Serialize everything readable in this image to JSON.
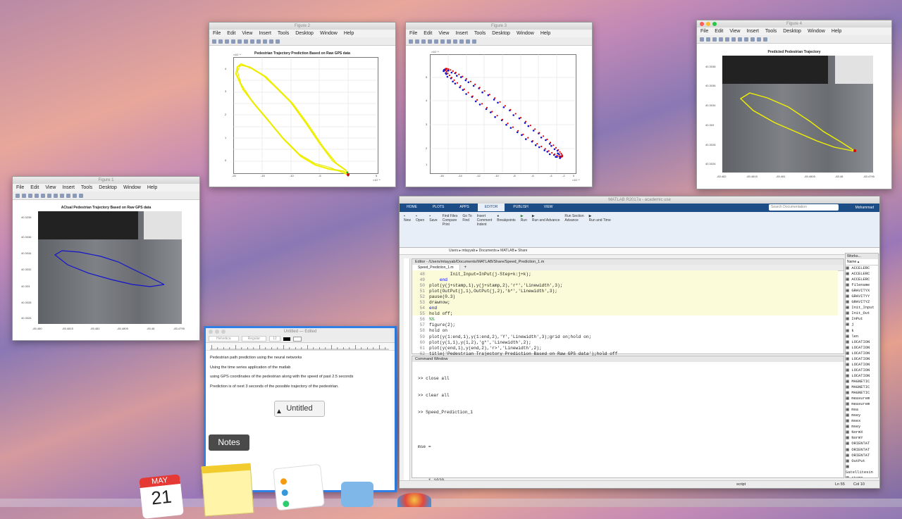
{
  "menus": [
    "File",
    "Edit",
    "View",
    "Insert",
    "Tools",
    "Desktop",
    "Window",
    "Help"
  ],
  "fig1": {
    "title": "Figure 1",
    "plot_title": "ACtual Pedestrian Trajectory Based on Raw GPS data",
    "xticks": [
      "-83.480",
      "-83.4815",
      "-83.481",
      "-83.4805",
      "-83.48",
      "-83.4795"
    ],
    "yticks": [
      "40.3238",
      "40.3036",
      "40.3034",
      "40.3032",
      "40.303",
      "40.3028",
      "40.3026"
    ]
  },
  "fig2": {
    "title": "Figure 2",
    "plot_title": "Pedestrian Trajectory Prediction Based on Raw GPS data",
    "xticks": [
      "-20",
      "-15",
      "-10",
      "-5",
      "0",
      "5"
    ],
    "yticks": [
      "4.5",
      "4",
      "3.5",
      "3",
      "2.5",
      "2",
      "1.5",
      "1",
      "0.5",
      "0",
      "-0.5"
    ],
    "exp_x": "×10⁻⁴",
    "exp_y": "×10⁻⁴"
  },
  "fig3": {
    "title": "Figure 3",
    "xticks": [
      "-16",
      "-14",
      "-12",
      "-10",
      "-8",
      "-6",
      "-4",
      "-2",
      "0"
    ],
    "yticks": [
      "5",
      "4",
      "3",
      "2",
      "1",
      "0"
    ],
    "exp_x": "×10⁻⁴",
    "exp_y": "×10⁻⁴"
  },
  "fig4": {
    "title": "Figure 4",
    "plot_title": "Predicted Pedestrian Trajectory",
    "xticks": [
      "-83.482",
      "-83.4815",
      "-83.481",
      "-83.4805",
      "-83.48",
      "-83.4795"
    ],
    "yticks": [
      "40.3038",
      "40.3036",
      "40.3034",
      "40.303",
      "40.3028",
      "40.3026"
    ]
  },
  "notes": {
    "title": "Untitled — Edited",
    "font": "Helvetica",
    "style": "Regular",
    "size": "12",
    "lines": [
      "Pedestrian path prediction using the neural networks",
      "Using the time series application of the matlab",
      "using GPS coordinates of the pedestrian along with the speed of past 2.5 seconds",
      "Prediction is of next 3 seconds of the possible trajectory of the pedestrian."
    ],
    "popup": "Untitled",
    "tooltip": "Notes"
  },
  "matlab": {
    "title": "MATLAB R2017a - academic use",
    "tabs": [
      "HOME",
      "PLOTS",
      "APPS",
      "EDITOR",
      "PUBLISH",
      "VIEW"
    ],
    "search": "Search Documentation",
    "user": "Mohammad",
    "ribbon": [
      "New",
      "Open",
      "Save",
      "Find Files",
      "Compare",
      "Print",
      "Go To",
      "Find",
      "Insert",
      "Comment",
      "Indent",
      "Breakpoints",
      "Run",
      "Run and Advance",
      "Run Section",
      "Advance",
      "Run and Time"
    ],
    "path": [
      "Users",
      "mtayyab",
      "Documents",
      "MATLAB",
      "Share"
    ],
    "editor_title": "Editor - /Users/mtayyab/Documents/MATLAB/Share/Speed_Prediction_1.m",
    "file_tab": "Speed_Prediction_1.m",
    "code": [
      {
        "n": "48",
        "t": "        Init_Input=InPut(j-Step+k:j+k);"
      },
      {
        "n": "49",
        "t": "    end"
      },
      {
        "n": "50",
        "t": "plot(y(j+stamp,1),y(j+stamp,2),'r*','Linewidth',3);"
      },
      {
        "n": "51",
        "t": "plot(OutPut(j,1),OutPut(j,2),'b*','Linewidth',3);"
      },
      {
        "n": "52",
        "t": "pause(0.3)"
      },
      {
        "n": "53",
        "t": "drawnow;"
      },
      {
        "n": "54",
        "t": "end"
      },
      {
        "n": "55",
        "t": "hold off;"
      },
      {
        "n": "56",
        "t": "%%"
      },
      {
        "n": "57",
        "t": "figure(2);"
      },
      {
        "n": "58",
        "t": "hold on"
      },
      {
        "n": "59",
        "t": "plot(y(1:end,1),y(1:end,2),'Y','Linewidth',3);grid on;hold on;"
      },
      {
        "n": "60",
        "t": "plot(y(1,1),y(1,2),'g*','Linewidth',2);"
      },
      {
        "n": "61",
        "t": "plot(y(end,1),y(end,2),'r>','Linewidth',2);"
      },
      {
        "n": "62",
        "t": "title('Pedestrian Trajectory Prediction Based on Raw GPS data');hold off"
      }
    ],
    "cmd_title": "Command Window",
    "cmd": [
      ">> close all",
      ">> clear all",
      ">> Speed_Prediction_1",
      "",
      "mse =",
      "",
      "    1.1029",
      "",
      ">>"
    ],
    "ws_title": "Works...",
    "ws_header": "Name ▴",
    "ws": [
      "ACCELERC",
      "ACCELERC",
      "ACCELERC",
      "filename",
      "GRAVITYX",
      "GRAVITYY",
      "GRAVITYZ",
      "Init_Input",
      "Init_Out",
      "InPut",
      "j",
      "k",
      "len",
      "LOCATION",
      "LOCATION",
      "LOCATION",
      "LOCATION",
      "LOCATION",
      "LOCATION",
      "LOCATION",
      "MAGNETIC",
      "MAGNETIC",
      "MAGNETIC",
      "measurem",
      "measurem",
      "msa",
      "msey",
      "msex",
      "msey",
      "NormX",
      "NormY",
      "ORIENTAT",
      "ORIENTAT",
      "ORIENTAT",
      "OutPut",
      "Satellitesin",
      "stamp",
      "Step"
    ],
    "status_script": "script",
    "status_ln": "Ln  55",
    "status_col": "Col  10"
  },
  "dock": {
    "cal_month": "MAY",
    "cal_day": "21"
  },
  "colors": {
    "ribbon": "#1d4d86",
    "yellow": "#f2f200",
    "red": "#e00000",
    "blue": "#1414cc"
  }
}
